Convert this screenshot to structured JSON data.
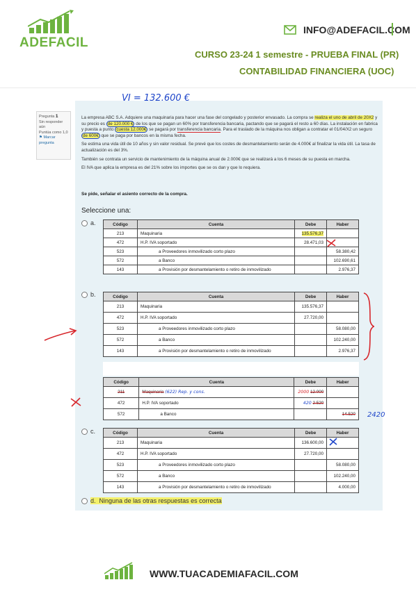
{
  "header": {
    "logo_text": "ADEFACIL",
    "email": "INFO@ADEFACIL.COM",
    "course": "CURSO 23-24 1 semestre - PRUEBA FINAL (PR)",
    "subject": "CONTABILIDAD FINANCIERA (UOC)"
  },
  "colors": {
    "brand_green": "#6db33f",
    "title_green": "#6a8c22",
    "panel_bg": "#e8f2f6",
    "pen_blue": "#1d44c9",
    "pen_red": "#d7262b",
    "highlight": "#f3f06a"
  },
  "annotation_vi": "VI = 132.600 €",
  "question_info": {
    "label": "Pregunta",
    "number": "1",
    "status": "Sin responder aún",
    "score": "Puntúa como 1,0",
    "flag": "Marcar pregunta"
  },
  "question": {
    "p1_a": "La empresa ABC S.A. Adquiere una maquinaria para hacer una fase del congelado y posterior envasado. La compra se ",
    "p1_hl1": "realiza el uno de abril de 20X2",
    "p1_b": " y su precio es ",
    "p1_price": "de 120.000 €",
    "p1_c": " de los que se pagan un 60% por transferencia bancaria, pactando que se pagará el resto a 60 días. La instalación en fabrica y puesta a punto ",
    "p1_install": "cuesta 12.000€",
    "p1_d": " se pagará por ",
    "p1_transfer": "transferencia bancaria",
    "p1_e": ". Para el traslado de la máquina nos obligan a contratar el 01/04/X2 un seguro ",
    "p1_insurance": "de 600€",
    "p1_f": " que se paga por bancos en la misma fecha.",
    "p2": "Se estima una vida útil de 10 años y sin valor residual. Se prevé que los costes de desmantelamiento serán de 4.000€ al finalizar la vida útil. La tasa de actualización es del 3%.",
    "p3": "También se contrata un servicio de mantenimiento de la máquina anual de 2.000€ que se realizará a los 6 meses de su puesta en marcha.",
    "p4": "El IVA que aplica la empresa es del 21% sobre los importes que se os dan y que lo requiera.",
    "prompt": "Se pide, señalar el asiento correcto de la compra.",
    "select_label": "Seleccione una:"
  },
  "table_headers": [
    "Código",
    "Cuenta",
    "Debe",
    "Haber"
  ],
  "options": [
    {
      "letter": "a.",
      "rows": [
        {
          "code": "213",
          "account": "Maquinaria",
          "debe": "135.576,37",
          "haber": ""
        },
        {
          "code": "472",
          "account": "H.P. IVA soportado",
          "debe": "28.471,03",
          "haber": ""
        },
        {
          "code": "523",
          "account": "a Proveedores inmovilizado corto plazo",
          "debe": "",
          "haber": "58.380,42"
        },
        {
          "code": "572",
          "account": "a Banco",
          "debe": "",
          "haber": "102.690,61"
        },
        {
          "code": "143",
          "account": "a Provisión por desmantelamiento o retiro de inmovilizado",
          "debe": "",
          "haber": "2.976,37"
        }
      ]
    },
    {
      "letter": "b.",
      "rows": [
        {
          "code": "213",
          "account": "Maquinaria",
          "debe": "135.576,37",
          "haber": ""
        },
        {
          "code": "472",
          "account": "H.P. IVA soportado",
          "debe": "27.720,00",
          "haber": ""
        },
        {
          "code": "523",
          "account": "a Proveedores inmovilizado corto plazo",
          "debe": "",
          "haber": "58.080,00"
        },
        {
          "code": "572",
          "account": "a Banco",
          "debe": "",
          "haber": "102.240,00"
        },
        {
          "code": "143",
          "account": "a Provisión por desmantelamiento o retiro de inmovilizado",
          "debe": "",
          "haber": "2.976,37"
        }
      ],
      "second_rows": [
        {
          "code": "211",
          "account": "Maquinaria",
          "debe": "12.000",
          "haber": ""
        },
        {
          "code": "472",
          "account": "H.P. IVA soportado",
          "debe": "2.520",
          "haber": ""
        },
        {
          "code": "572",
          "account": "a Banco",
          "debe": "",
          "haber": "14.520"
        }
      ]
    },
    {
      "letter": "c.",
      "rows": [
        {
          "code": "213",
          "account": "Maquinaria",
          "debe": "136.600,00",
          "haber": ""
        },
        {
          "code": "472",
          "account": "H.P. IVA soportado",
          "debe": "27.720,00",
          "haber": ""
        },
        {
          "code": "523",
          "account": "a Proveedores inmovilizado corto plazo",
          "debe": "",
          "haber": "58.080,00"
        },
        {
          "code": "572",
          "account": "a Banco",
          "debe": "",
          "haber": "102.240,00"
        },
        {
          "code": "143",
          "account": "a Provisión por desmantelamiento o retiro de inmovilizado",
          "debe": "",
          "haber": "4.000,00"
        }
      ]
    },
    {
      "letter": "d.",
      "text": "Ninguna de las otras respuestas es correcta"
    }
  ],
  "annotations": {
    "b2_account": "(622) Rep. y cons.",
    "b2_debe": "2000",
    "b2_iva": "420",
    "b2_haber": "2420"
  },
  "footer": {
    "website": "WWW.TUACADEMIAFACIL.COM"
  }
}
